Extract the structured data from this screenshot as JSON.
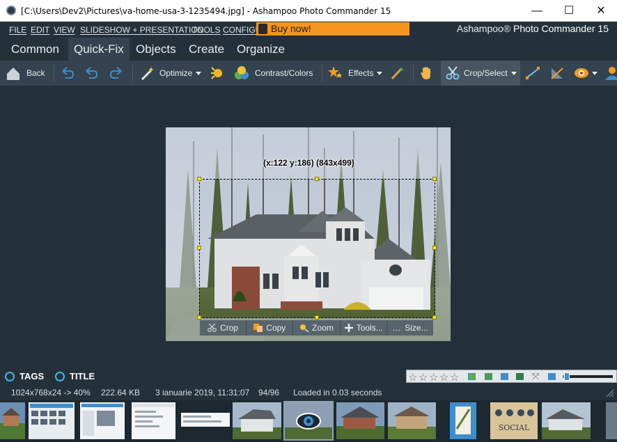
{
  "window": {
    "title": "[C:\\Users\\Dev2\\Pictures\\va-home-usa-3-1235494.jpg] - Ashampoo Photo Commander 15",
    "minimize": "—",
    "maximize": "☐",
    "close": "✕"
  },
  "menu": {
    "items": [
      "FILE",
      "EDIT",
      "VIEW",
      "SLIDESHOW + PRESENTATION",
      "TOOLS",
      "CONFIGU"
    ],
    "buy_now": "Buy now!",
    "brand_prefix": "Ashampoo®",
    "brand_name": "Photo Commander 15"
  },
  "tabs": [
    "Common",
    "Quick-Fix",
    "Objects",
    "Create",
    "Organize"
  ],
  "active_tab": "Quick-Fix",
  "toolbar": {
    "back": "Back",
    "optimize": "Optimize",
    "contrast": "Contrast/Colors",
    "effects": "Effects",
    "crop_select": "Crop/Select"
  },
  "crop": {
    "info": "(x:122 y:186) (843x499)",
    "buttons": {
      "crop": "Crop",
      "copy": "Copy",
      "zoom": "Zoom",
      "tools": "Tools...",
      "size": "Size..."
    }
  },
  "panels": {
    "tags": "TAGS",
    "title": "TITLE"
  },
  "status": {
    "dimensions": "1024x768x24 -> 40%",
    "filesize": "222.64 KB",
    "date": "3 ianuarie 2019, 11:31:07",
    "position": "94/96",
    "load": "Loaded in 0.03 seconds"
  },
  "rating": {
    "stars": 0,
    "max": 5
  },
  "zoom_level": 0.08,
  "colors": {
    "accent": "#f7941d",
    "app_bg": "#23303a",
    "toolbar_bg": "#34434f",
    "selection_handle": "#ffe800",
    "tag_ring": "#46b4f0"
  },
  "icons": [
    "home-icon",
    "undo-icon",
    "redo-icon",
    "magic-wand-icon",
    "sun-icon",
    "color-balls-icon",
    "star-effects-icon",
    "brush-icon",
    "hand-icon",
    "scissors-icon",
    "line-icon",
    "triangle-icon",
    "eye-icon",
    "person-icon"
  ]
}
